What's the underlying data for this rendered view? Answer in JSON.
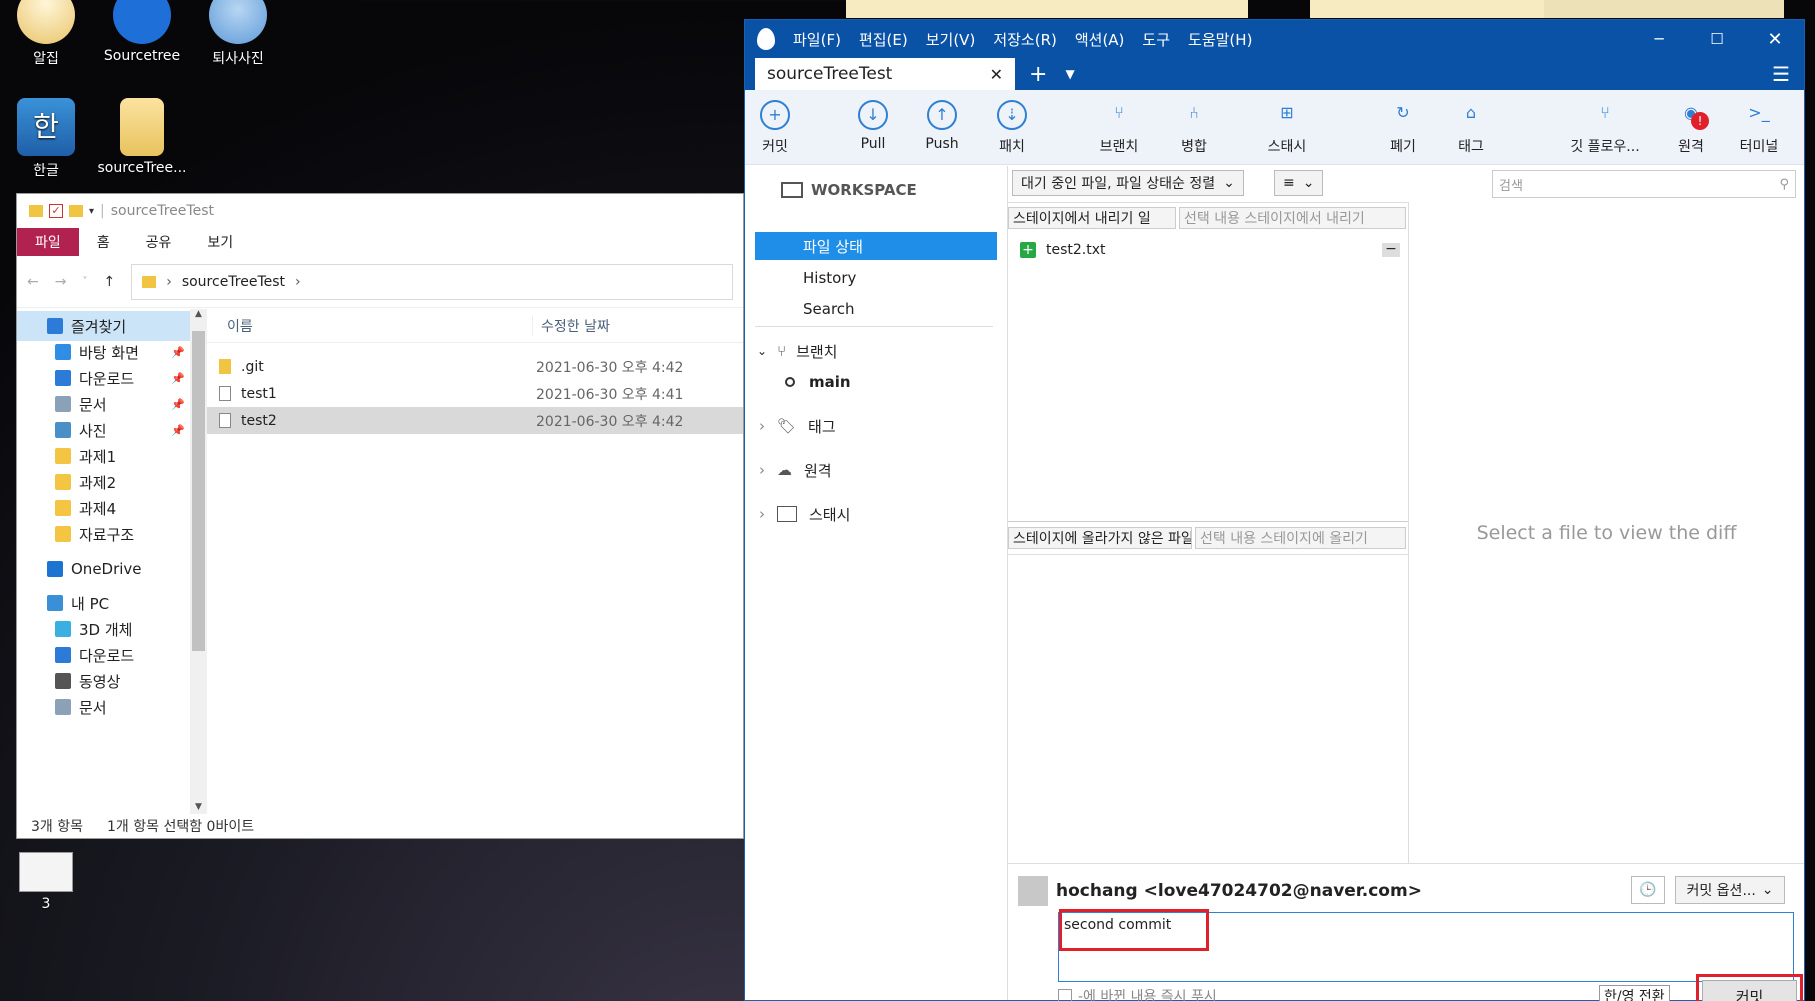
{
  "desktop": {
    "icons": [
      "알집",
      "Sourcetree",
      "퇴사사진",
      "한글",
      "sourceTree...",
      "3"
    ]
  },
  "explorer": {
    "title": "sourceTreeTest",
    "ribbon_tabs": [
      "파일",
      "홈",
      "공유",
      "보기"
    ],
    "address_path": "sourceTreeTest",
    "nav_items": [
      {
        "label": "즐겨찾기",
        "icon": "star-icon",
        "color": "#2d7bd8"
      },
      {
        "label": "바탕 화면",
        "icon": "desktop-icon",
        "color": "#2f8de4"
      },
      {
        "label": "다운로드",
        "icon": "download-icon",
        "color": "#2d7bd8"
      },
      {
        "label": "문서",
        "icon": "document-icon",
        "color": "#8aa1b8"
      },
      {
        "label": "사진",
        "icon": "picture-icon",
        "color": "#4a90c8"
      },
      {
        "label": "과제1",
        "icon": "folder-icon",
        "color": "#f4c542"
      },
      {
        "label": "과제2",
        "icon": "folder-icon",
        "color": "#f4c542"
      },
      {
        "label": "과제4",
        "icon": "folder-icon",
        "color": "#f4c542"
      },
      {
        "label": "자료구조",
        "icon": "folder-icon",
        "color": "#f4c542"
      },
      {
        "label": "OneDrive",
        "icon": "cloud-icon",
        "color": "#1d73d1"
      },
      {
        "label": "내 PC",
        "icon": "pc-icon",
        "color": "#3a8fd6"
      },
      {
        "label": "3D 개체",
        "icon": "cube-icon",
        "color": "#3ab0e0"
      },
      {
        "label": "다운로드",
        "icon": "download-icon",
        "color": "#2d7bd8"
      },
      {
        "label": "동영상",
        "icon": "video-icon",
        "color": "#555"
      },
      {
        "label": "문서",
        "icon": "document-icon",
        "color": "#8aa1b8"
      }
    ],
    "columns": [
      "이름",
      "수정한 날짜"
    ],
    "files": [
      {
        "name": ".git",
        "date": "2021-06-30 오후 4:42",
        "icon": "folder-icon"
      },
      {
        "name": "test1",
        "date": "2021-06-30 오후 4:41",
        "icon": "text-file-icon"
      },
      {
        "name": "test2",
        "date": "2021-06-30 오후 4:42",
        "icon": "text-file-icon"
      }
    ],
    "status": {
      "count": "3개 항목",
      "selection": "1개 항목 선택함 0바이트"
    }
  },
  "sourcetree": {
    "menu": [
      "파일(F)",
      "편집(E)",
      "보기(V)",
      "저장소(R)",
      "액션(A)",
      "도구",
      "도움말(H)"
    ],
    "tab_title": "sourceTreeTest",
    "toolbar": [
      {
        "label": "커밋",
        "icon": "plus-circle-icon"
      },
      {
        "label": "Pull",
        "icon": "pull-icon"
      },
      {
        "label": "Push",
        "icon": "push-icon"
      },
      {
        "label": "패치",
        "icon": "fetch-icon"
      },
      {
        "label": "브랜치",
        "icon": "branch-icon"
      },
      {
        "label": "병합",
        "icon": "merge-icon"
      },
      {
        "label": "스태시",
        "icon": "stash-icon"
      },
      {
        "label": "폐기",
        "icon": "discard-icon"
      },
      {
        "label": "태그",
        "icon": "tag-icon"
      },
      {
        "label": "깃 플로우...",
        "icon": "git-flow-icon"
      },
      {
        "label": "원격",
        "icon": "remote-icon"
      },
      {
        "label": "터미널",
        "icon": "terminal-icon"
      }
    ],
    "sidebar": {
      "workspace": "WORKSPACE",
      "file_status": "파일 상태",
      "history": "History",
      "search": "Search",
      "branches": "브랜치",
      "current_branch": "main",
      "tags": "태그",
      "remotes": "원격",
      "stashes": "스태시"
    },
    "filter_label": "대기 중인 파일, 파일 상태순 정렬",
    "view_icon": "≡",
    "search_placeholder": "검색",
    "staged": {
      "unstage_all": "스테이지에서 내리기 일",
      "unstage_selected": "선택 내용 스테이지에서 내리기",
      "file": "test2.txt"
    },
    "unstaged": {
      "header": "스테이지에 올라가지 않은 파일",
      "stage_selected": "선택 내용 스테이지에 올리기"
    },
    "diff_placeholder": "Select a file to view the diff",
    "commit": {
      "author": "hochang <love47024702@naver.com>",
      "message": "second commit",
      "options": "커밋 옵션...",
      "push_immediately": "-에 바뀐 내용 즉시 푸시",
      "ime": "한/영 전환",
      "button": "커밋"
    },
    "highlight_color": "#e0202a"
  }
}
